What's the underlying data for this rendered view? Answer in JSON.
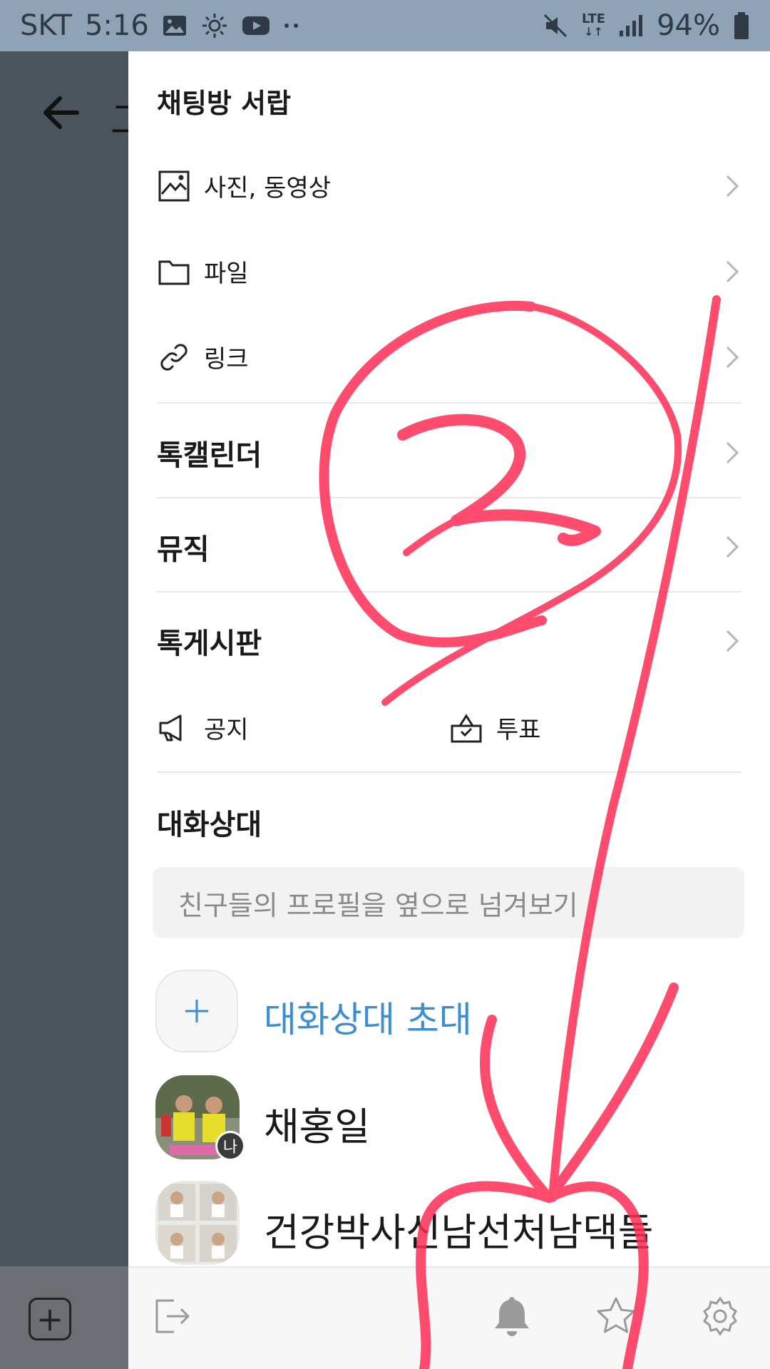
{
  "status_bar": {
    "carrier": "SKT",
    "time": "5:16",
    "network": "LTE",
    "battery": "94%",
    "left_icons": [
      "image-icon",
      "sun-icon",
      "youtube-icon",
      "more-dots-icon"
    ],
    "right_icons": [
      "mute-icon",
      "lte-icon",
      "signal-icon",
      "battery-icon"
    ]
  },
  "background": {
    "title_fragment": "그"
  },
  "drawer": {
    "drawer_title": "채팅방 서랍",
    "items": [
      {
        "label": "사진, 동영상",
        "icon": "photo-icon"
      },
      {
        "label": "파일",
        "icon": "folder-icon"
      },
      {
        "label": "링크",
        "icon": "link-icon"
      },
      {
        "label": "톡캘린더"
      },
      {
        "label": "뮤직"
      },
      {
        "label": "톡게시판"
      }
    ],
    "quick": [
      {
        "label": "공지",
        "icon": "megaphone-icon"
      },
      {
        "label": "투표",
        "icon": "ballot-box-icon"
      }
    ],
    "members_title": "대화상대",
    "search_placeholder": "친구들의 프로필을 옆으로 넘겨보기",
    "invite_label": "대화상대 초대",
    "members": [
      {
        "name": "채홍일",
        "badge": "나"
      },
      {
        "name": "건강박사신남선처남댁들"
      }
    ],
    "bottom_icons": [
      "exit-icon",
      "bell-icon",
      "star-icon",
      "settings-icon"
    ]
  },
  "annotation": {
    "handwritten_mark": "2",
    "color": "#ff2d55"
  }
}
